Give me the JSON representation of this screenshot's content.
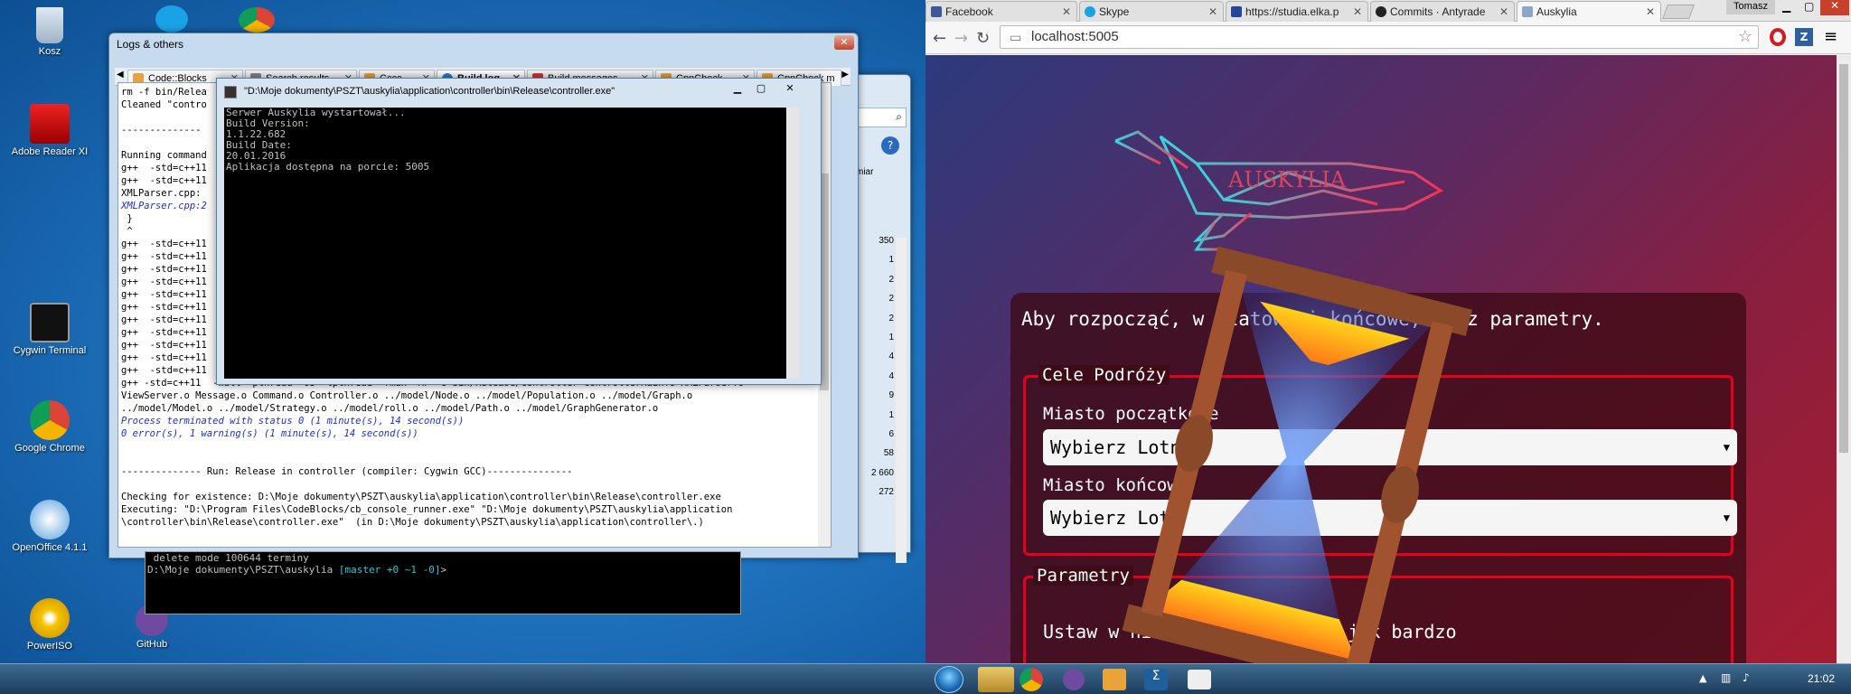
{
  "desktop": {
    "icons": [
      {
        "label": "Kosz"
      },
      {
        "label": "Adobe Reader XI"
      },
      {
        "label": "Cygwin Terminal"
      },
      {
        "label": "Google Chrome"
      },
      {
        "label": "OpenOffice 4.1.1"
      },
      {
        "label": "PowerISO"
      },
      {
        "label": "GitHub"
      }
    ]
  },
  "logs_window": {
    "title": "Logs & others",
    "tabs": [
      "Code::Blocks",
      "Search results",
      "Cccc",
      "Build log",
      "Build messages",
      "CppCheck",
      "CppCheck m"
    ],
    "log_lines": [
      "rm -f bin/Relea",
      "Cleaned \"contro",
      "",
      "-------------- ",
      "",
      "Running command",
      "g++  -std=c++11",
      "g++  -std=c++11",
      "XMLParser.cpp:",
      "XMLParser.cpp:2",
      " }",
      " ^",
      "g++  -std=c++11",
      "g++  -std=c++11",
      "g++  -std=c++11",
      "g++  -std=c++11",
      "g++  -std=c++11",
      "g++  -std=c++11",
      "g++  -std=c++11",
      "g++  -std=c++11",
      "g++  -std=c++11",
      "g++  -std=c++11",
      "g++  -std=c++11",
      "g++ -std=c++11  -Wall -pthread -O3 -lpthread -fmax -MF -o bin/Release/controller controllerMain.o XMLParser.o",
      "ViewServer.o Message.o Command.o Controller.o ../model/Node.o ../model/Population.o ../model/Graph.o",
      "../model/Model.o ../model/Strategy.o ../model/roll.o ../model/Path.o ../model/GraphGenerator.o",
      "Process terminated with status 0 (1 minute(s), 14 second(s))",
      "0 error(s), 1 warning(s) (1 minute(s), 14 second(s))",
      "",
      "",
      "-------------- Run: Release in controller (compiler: Cygwin GCC)---------------",
      "",
      "Checking for existence: D:\\Moje dokumenty\\PSZT\\auskylia\\application\\controller\\bin\\Release\\controller.exe",
      "Executing: \"D:\\Program Files\\CodeBlocks/cb_console_runner.exe\" \"D:\\Moje dokumenty\\PSZT\\auskylia\\application",
      "\\controller\\bin\\Release\\controller.exe\"  (in D:\\Moje dokumenty\\PSZT\\auskylia\\application\\controller\\.)"
    ],
    "side_numbers": [
      "350",
      "1",
      "2",
      "2",
      "2",
      "1",
      "4",
      "4",
      "9",
      "1",
      "6",
      "58",
      "2 660",
      "272"
    ]
  },
  "console_window": {
    "title": "\"D:\\Moje dokumenty\\PSZT\\auskylia\\application\\controller\\bin\\Release\\controller.exe\"",
    "lines": [
      "Serwer Auskylia wystartował...",
      "Build Version:",
      "1.1.22.682",
      "Build Date:",
      "20.01.2016",
      "Aplikacja dostępna na porcie: 5005"
    ]
  },
  "git_terminal": {
    "line1": " delete mode 100644 terminy",
    "line2_path": "D:\\Moje dokumenty\\PSZT\\auskylia ",
    "line2_branch": "[master +0 ~1 -0]",
    "line2_end": ">"
  },
  "browser": {
    "tabs": [
      "Facebook",
      "Skype",
      "https://studia.elka.p",
      "Commits · Antyrade",
      "Auskylia"
    ],
    "user": "Tomasz",
    "url": "localhost:5005",
    "page": {
      "logo_text": "AUSKYLIA",
      "intro": "Aby rozpocząć, w                            rzatowe i końcowe, oraz parametry.",
      "fieldset1_legend": "Cele Podróży",
      "start_label": "Miasto początkowe",
      "start_select": "Wybierz Lotni",
      "end_label": "Miasto końcowe",
      "end_select": "Wybierz Lotn",
      "fieldset2_legend": "Parametry",
      "params_text": "Ustaw w          nik każdego param     , jak bardzo"
    }
  },
  "taskbar": {
    "clock": "21:02"
  },
  "colors": {
    "accent_red": "#e6001a",
    "console_bg": "#000000",
    "log_blue": "#1d2ed6"
  }
}
